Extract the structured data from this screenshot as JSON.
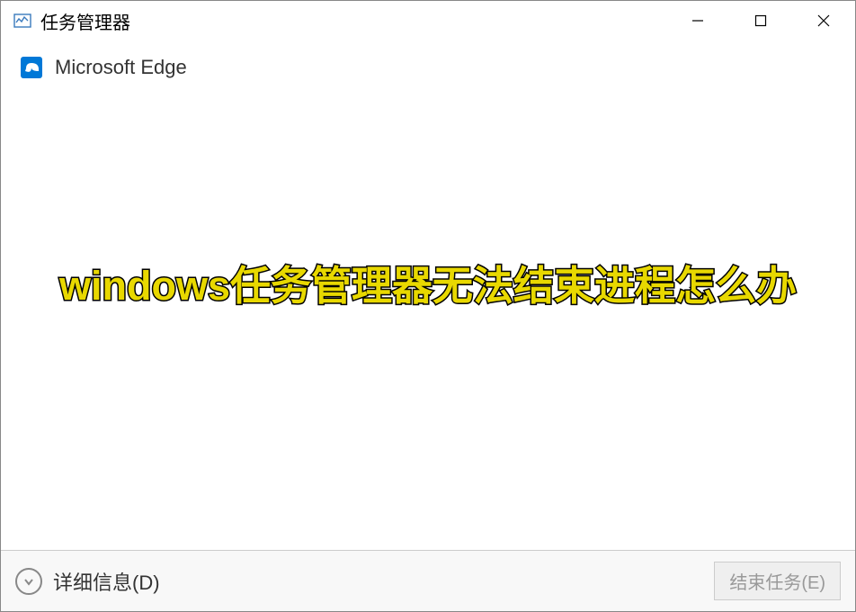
{
  "titlebar": {
    "title": "任务管理器",
    "icon": "task-manager-icon"
  },
  "process": {
    "name": "Microsoft Edge",
    "icon": "edge-icon"
  },
  "overlay": {
    "text": "windows任务管理器无法结束进程怎么办"
  },
  "footer": {
    "expand_label": "详细信息(D)",
    "end_task_label": "结束任务(E)"
  }
}
